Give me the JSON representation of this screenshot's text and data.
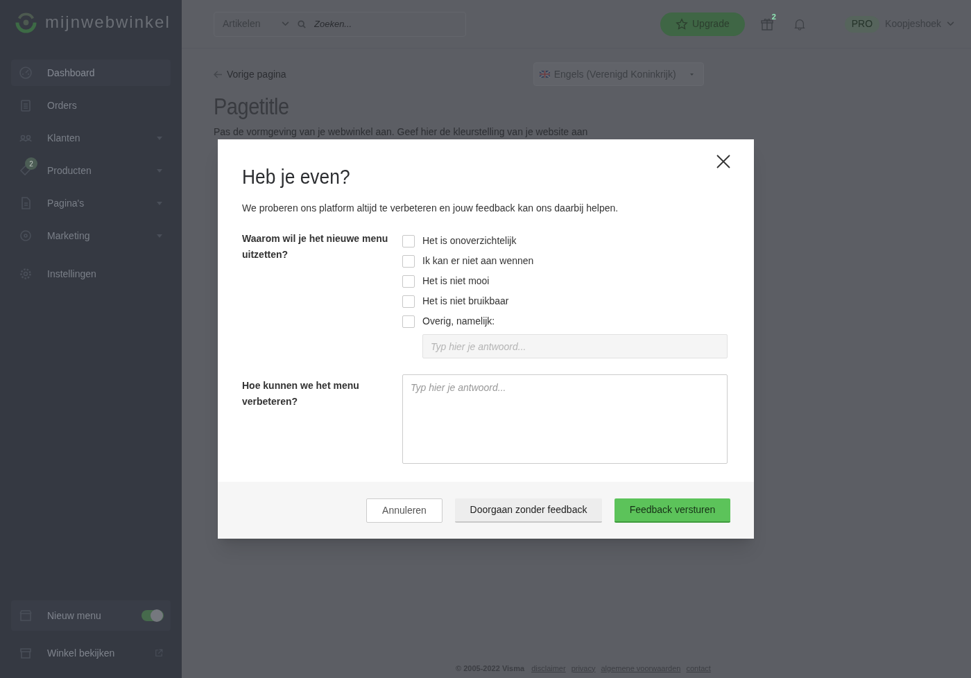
{
  "logo": {
    "text": "mijnwebwinkel"
  },
  "topbar": {
    "search_scope": "Artikelen",
    "search_placeholder": "Zoeken...",
    "upgrade_button": "Upgrade",
    "gift_badge": "2",
    "plan_badge": "PRO",
    "account": "Koopjeshoek"
  },
  "sidebar": {
    "items": [
      {
        "label": "Dashboard",
        "selected": true,
        "has_submenu": false
      },
      {
        "label": "Orders",
        "selected": false,
        "has_submenu": false
      },
      {
        "label": "Klanten",
        "selected": false,
        "has_submenu": true
      },
      {
        "label": "Producten",
        "selected": false,
        "has_submenu": true,
        "badge": "2"
      },
      {
        "label": "Pagina's",
        "selected": false,
        "has_submenu": true
      },
      {
        "label": "Marketing",
        "selected": false,
        "has_submenu": true
      },
      {
        "label": "Instellingen",
        "selected": false,
        "has_submenu": false
      }
    ],
    "bottom": [
      {
        "kind": "toggle",
        "label": "Nieuw menu",
        "on": true
      },
      {
        "kind": "link",
        "label": "Winkel bekijken"
      }
    ]
  },
  "page": {
    "back_link": "Vorige pagina",
    "language": "Engels (Verenigd Koninkrijk)",
    "title": "Pagetitle",
    "intro": "Pas de vormgeving van je webwinkel aan. Geef hier de kleurstelling van je website aan"
  },
  "dialog": {
    "title": "Heb je even?",
    "intro": "We proberen ons platform altijd te verbeteren en jouw feedback kan ons daarbij helpen.",
    "questions": [
      {
        "kind": "checkboxes",
        "label": "Waarom wil je het nieuwe menu uitzetten?",
        "options": [
          {
            "label": "Het is onoverzichtelijk",
            "checked": false
          },
          {
            "label": "Ik kan er niet aan wennen",
            "checked": false
          },
          {
            "label": "Het is niet mooi",
            "checked": false
          },
          {
            "label": "Het is niet bruikbaar",
            "checked": false
          },
          {
            "label": "Overig, namelijk:",
            "checked": false
          }
        ],
        "other_placeholder": "Typ hier je antwoord..."
      },
      {
        "kind": "textarea",
        "label": "Hoe kunnen we het menu verbeteren?",
        "placeholder": "Typ hier je antwoord..."
      }
    ],
    "buttons": [
      {
        "label": "Annuleren",
        "kind": "outline"
      },
      {
        "label": "Doorgaan zonder feedback",
        "kind": "default"
      },
      {
        "label": "Feedback versturen",
        "kind": "primary"
      }
    ]
  },
  "footer": {
    "copyright": "© 2005-2022 Visma",
    "links": [
      "disclaimer",
      "privacy",
      "algemene voorwaarden",
      "contact"
    ]
  }
}
